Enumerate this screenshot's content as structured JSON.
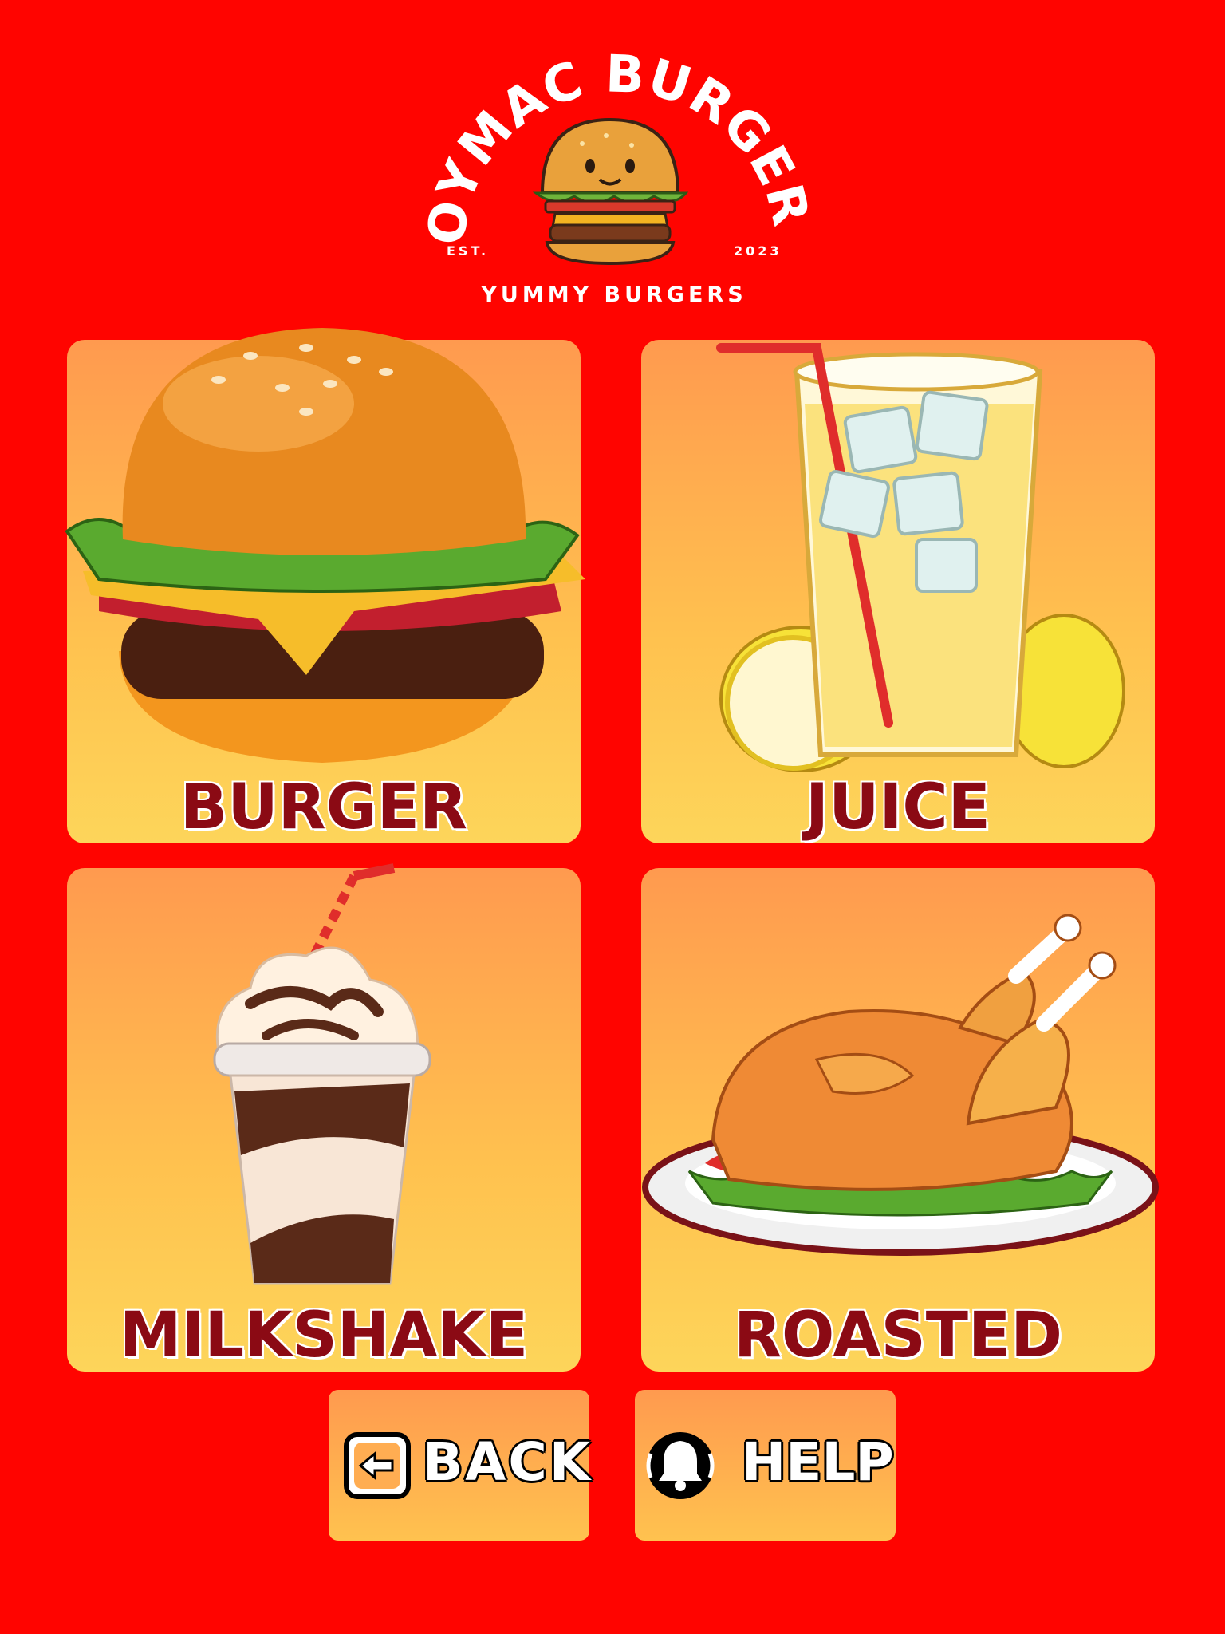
{
  "brand": {
    "name": "JOYMAC BURGERS",
    "est_label": "EST.",
    "year": "2023",
    "tagline": "YUMMY BURGERS"
  },
  "menu": {
    "items": [
      {
        "label": "BURGER",
        "icon": "burger-icon"
      },
      {
        "label": "JUICE",
        "icon": "juice-icon"
      },
      {
        "label": "MILKSHAKE",
        "icon": "milkshake-icon"
      },
      {
        "label": "ROASTED",
        "icon": "roasted-chicken-icon"
      }
    ]
  },
  "actions": {
    "back_label": "BACK",
    "back_icon": "back-arrow-icon",
    "help_label": "HELP",
    "help_icon": "bell-icon"
  },
  "colors": {
    "background": "#ff0400",
    "tile_top": "#ff9a4f",
    "tile_bottom": "#fdd55a",
    "label_text": "#8b0a14"
  }
}
